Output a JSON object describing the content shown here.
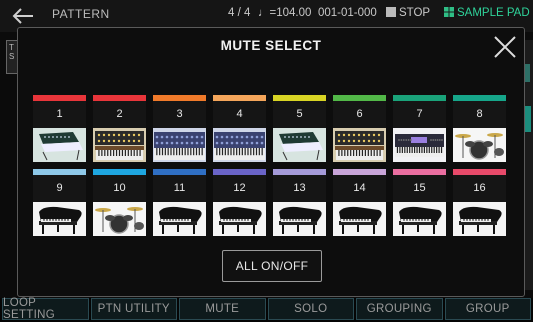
{
  "topbar": {
    "title": "PATTERN",
    "time_sig": "4 / 4",
    "tempo": "♩=104.00",
    "position": "001-01-000",
    "stop_label": "STOP",
    "sample_pad_label": "SAMPLE PAD"
  },
  "background": {
    "left_panel_text": "T S"
  },
  "dialog": {
    "title": "MUTE SELECT",
    "all_button": "ALL ON/OFF",
    "pads": [
      {
        "number": "1",
        "color": "#e8353a",
        "instrument": "modular-synth-icon"
      },
      {
        "number": "2",
        "color": "#e8353a",
        "instrument": "synth-rack-icon"
      },
      {
        "number": "3",
        "color": "#f07a2a",
        "instrument": "keyboard-synth-icon"
      },
      {
        "number": "4",
        "color": "#f4a55a",
        "instrument": "keyboard-synth-icon"
      },
      {
        "number": "5",
        "color": "#d8d424",
        "instrument": "modular-synth-icon"
      },
      {
        "number": "6",
        "color": "#52b848",
        "instrument": "synth-rack-icon"
      },
      {
        "number": "7",
        "color": "#1aa37a",
        "instrument": "workstation-icon"
      },
      {
        "number": "8",
        "color": "#16a68a",
        "instrument": "drum-kit-icon"
      },
      {
        "number": "9",
        "color": "#8ec8e8",
        "instrument": "grand-piano-icon"
      },
      {
        "number": "10",
        "color": "#1ea6e0",
        "instrument": "drum-kit-icon"
      },
      {
        "number": "11",
        "color": "#2f6fc4",
        "instrument": "grand-piano-icon"
      },
      {
        "number": "12",
        "color": "#6a64c8",
        "instrument": "grand-piano-icon"
      },
      {
        "number": "13",
        "color": "#a49ad8",
        "instrument": "grand-piano-icon"
      },
      {
        "number": "14",
        "color": "#c8a4d8",
        "instrument": "grand-piano-icon"
      },
      {
        "number": "15",
        "color": "#ea6ea0",
        "instrument": "grand-piano-icon"
      },
      {
        "number": "16",
        "color": "#e84a6a",
        "instrument": "grand-piano-icon"
      }
    ]
  },
  "tabs": [
    "LOOP SETTING",
    "PTN UTILITY",
    "MUTE",
    "SOLO",
    "GROUPING",
    "GROUP"
  ]
}
